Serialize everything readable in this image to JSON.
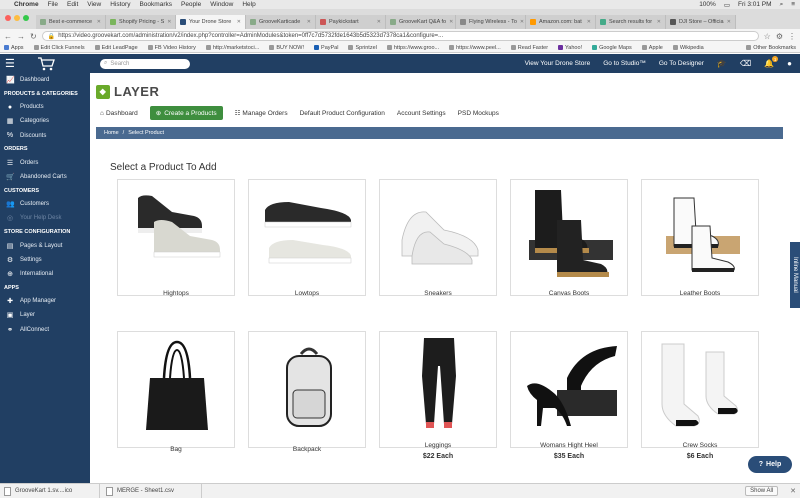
{
  "os_menubar": {
    "items": [
      "Chrome",
      "File",
      "Edit",
      "View",
      "History",
      "Bookmarks",
      "People",
      "Window",
      "Help"
    ],
    "battery": "100%",
    "clock": "Fri 3:01 PM"
  },
  "tabs": [
    {
      "label": "Best e-commerce"
    },
    {
      "label": "Shopify Pricing - S"
    },
    {
      "label": "Your Drone Store",
      "active": true
    },
    {
      "label": "GrooveKarticade"
    },
    {
      "label": "Paykickstart"
    },
    {
      "label": "GrooveKart Q&A fo"
    },
    {
      "label": "Flying Wireless - To"
    },
    {
      "label": "Amazon.com: bat"
    },
    {
      "label": "Search results for"
    },
    {
      "label": "DJI Store – Officia"
    }
  ],
  "url": "https://video.groovekart.com/administration/v2/index.php?controller=AdminModules&token=0ff7c7d5732fde1643b5d5323d7378ca1&configure=...",
  "bookmarks": [
    "Apps",
    "Edit Click Funnels",
    "Edit LeadPage",
    "FB Video History",
    "http://marketstoci...",
    "BUY NOW!",
    "PayPal",
    "Sprintzel",
    "https://www.groo...",
    "https://www.peel...",
    "Read Faster",
    "Yahoo!",
    "Google Maps",
    "Apple",
    "Wikipedia"
  ],
  "bookmarks_other": "Other Bookmarks",
  "topnav": {
    "search_placeholder": "Search",
    "links": [
      "View Your Drone Store",
      "Go to Studio™",
      "Go To Designer"
    ],
    "notif_count": "1"
  },
  "sidebar": {
    "dashboard": "Dashboard",
    "sec_products": "PRODUCTS & CATEGORIES",
    "products": "Products",
    "categories": "Categories",
    "discounts": "Discounts",
    "sec_orders": "ORDERS",
    "orders": "Orders",
    "abandoned": "Abandoned Carts",
    "sec_customers": "CUSTOMERS",
    "customers": "Customers",
    "helpdesk": "Your Help Desk",
    "sec_config": "STORE CONFIGURATION",
    "pages": "Pages & Layout",
    "settings": "Settings",
    "international": "International",
    "sec_apps": "APPS",
    "appmanager": "App Manager",
    "layer": "Layer",
    "allconnect": "AllConnect"
  },
  "brand": "LAYER",
  "subnav": {
    "dashboard": "Dashboard",
    "create": "Create a Products",
    "manage": "Manage Orders",
    "default_config": "Default Product Configuration",
    "account": "Account Settings",
    "psd": "PSD Mockups"
  },
  "breadcrumb": {
    "home": "Home",
    "sep": "/",
    "current": "Select Product"
  },
  "page_title": "Select a Product To Add",
  "products": [
    {
      "name": "Hightops",
      "price": ""
    },
    {
      "name": "Lowtops",
      "price": ""
    },
    {
      "name": "Sneakers",
      "price": ""
    },
    {
      "name": "Canvas Boots",
      "price": ""
    },
    {
      "name": "Leather Boots",
      "price": ""
    },
    {
      "name": "Bag",
      "price": ""
    },
    {
      "name": "Backpack",
      "price": ""
    },
    {
      "name": "Leggings",
      "price": "$22 Each"
    },
    {
      "name": "Womans Hight Heel",
      "price": "$35 Each"
    },
    {
      "name": "Crew Socks",
      "price": "$6 Each"
    }
  ],
  "inline_manual": "Inline Manual",
  "help": "Help",
  "downloads": [
    {
      "label": "GrooveKart 1.sv....ico"
    },
    {
      "label": "MERGE - Sheet1.csv"
    }
  ],
  "show_all": "Show All"
}
